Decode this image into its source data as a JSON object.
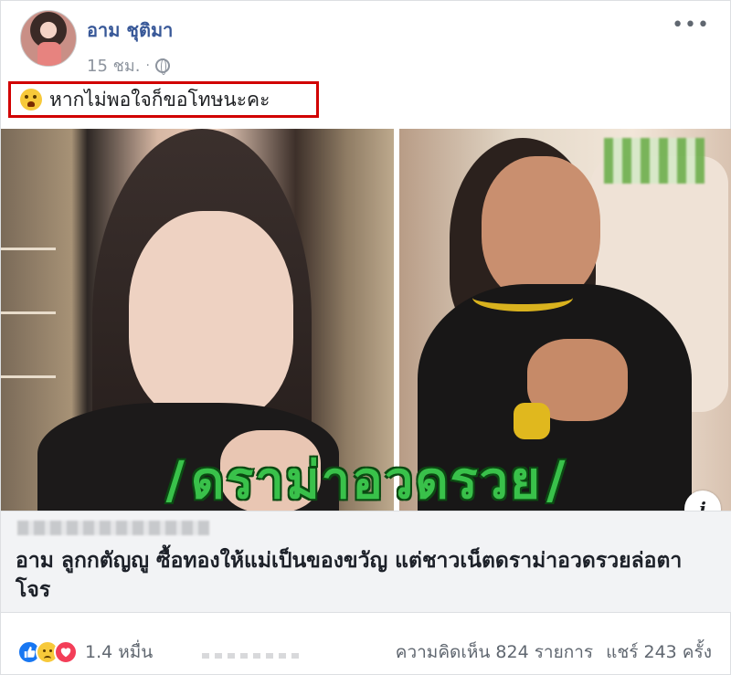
{
  "post": {
    "author": "อาม ชุติมา",
    "time": "15 ชม.",
    "separator": "·",
    "more_icon": "more-icon",
    "caption": "หากไม่พอใจก็ขอโทษนะคะ",
    "caption_highlight_color": "#d10000"
  },
  "image": {
    "overlay_text": "ดราม่าอวดรวย",
    "slash": "/",
    "overlay_color": "#39c14a",
    "info_label": "i"
  },
  "link": {
    "title": "อาม ลูกกตัญญู ซื้อทองให้แม่เป็นของขวัญ แต่ชาวเน็ตดราม่าอวดรวยล่อตาโจร"
  },
  "footer": {
    "reaction_count": "1.4 หมื่น",
    "comments": "ความคิดเห็น 824 รายการ",
    "shares": "แชร์ 243 ครั้ง",
    "reactions": [
      "like-icon",
      "sad-icon",
      "love-icon"
    ],
    "brand_color": "#385898"
  }
}
